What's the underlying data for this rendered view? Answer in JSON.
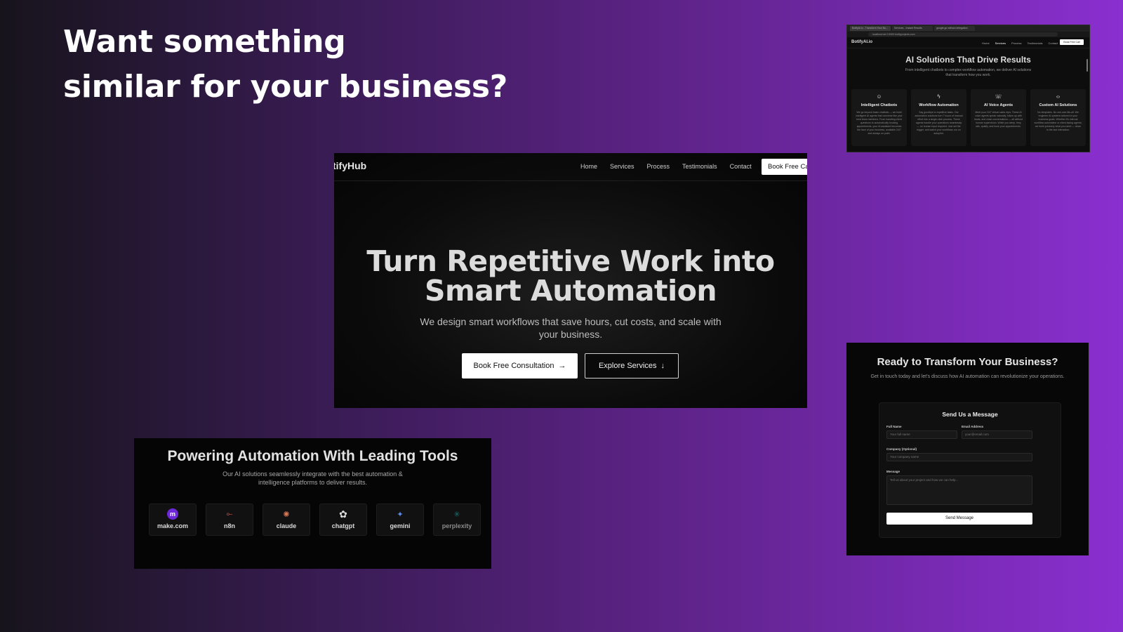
{
  "headline": {
    "line1": "Want something",
    "line2": "similar for your business?"
  },
  "hero": {
    "logo": "tifyHub",
    "nav": [
      "Home",
      "Services",
      "Process",
      "Testimonials",
      "Contact"
    ],
    "nav_cta": "Book Free Ca",
    "title_line1": "Turn Repetitive Work into",
    "title_line2": "Smart Automation",
    "subtitle": "We design smart workflows that save hours, cut costs, and scale with your business.",
    "primary_button": "Book Free Consultation",
    "primary_icon": "→",
    "secondary_button": "Explore Services",
    "secondary_icon": "↓"
  },
  "services_preview": {
    "tabs": [
      "BotifyAI.io - Transform Your Bu...",
      "Services - Instant Results",
      "google.go without delegation"
    ],
    "address": "localhost:net 3 5000 botifyprojects.com",
    "logo": "BotifyAI.io",
    "nav": [
      "Home",
      "Services",
      "Process",
      "Testimonials",
      "Contact"
    ],
    "nav_cta": "Book Free Call",
    "title": "AI Solutions That Drive Results",
    "subtitle": "From intelligent chatbots to complex workflow automation, we deliver AI solutions that transform how you work.",
    "cards": [
      {
        "icon": "robot-icon",
        "glyph": "☺",
        "title": "Intelligent Chatbots",
        "body": "We go beyond basic chatbots — we build intelligent AI agents that converse like your best team members. From handling client questions to automatically booking appointments, your AI assistant becomes the face of your business, available 24/7 and always on point."
      },
      {
        "icon": "lightning-icon",
        "glyph": "ϟ",
        "title": "Workflow Automation",
        "body": "Say goodbye to repetitive tasks. Our automation solutions turn 7 hours of manual effort into a single-click process. These agents handle your operations seamlessly — no human input required. Just set the trigger, and watch your workflows run on autopilot."
      },
      {
        "icon": "phone-icon",
        "glyph": "☏",
        "title": "AI Voice Agents",
        "body": "Meet your 24/7 virtual sales reps. These AI voice agents speak naturally, follow up with leads, and close conversations — all without human supervision. While you sleep, they talk, qualify, and book your appointments."
      },
      {
        "icon": "code-icon",
        "glyph": "‹›",
        "title": "Custom AI Solutions",
        "body": "No templates. No one-size-fits-all. We engineer AI systems tailored to your business goals. Whether it's internal workflow automation or client-facing agents, we build precisely what you need — down to the last interaction."
      }
    ]
  },
  "tools": {
    "title": "Powering Automation With Leading Tools",
    "subtitle": "Our AI solutions seamlessly integrate with the best automation & intelligence platforms to deliver results.",
    "items": [
      {
        "label": "make.com",
        "icon": "make-icon",
        "glyph": "m",
        "color": "#6d28d9"
      },
      {
        "label": "n8n",
        "icon": "n8n-icon",
        "glyph": "⟜",
        "color": "#e8625c"
      },
      {
        "label": "claude",
        "icon": "claude-icon",
        "glyph": "✺",
        "color": "#d97757"
      },
      {
        "label": "chatgpt",
        "icon": "chatgpt-icon",
        "glyph": "✿",
        "color": "#e0e0e0"
      },
      {
        "label": "gemini",
        "icon": "gemini-icon",
        "glyph": "✦",
        "color": "#5b8def"
      },
      {
        "label": "perplexity",
        "icon": "perplexity-icon",
        "glyph": "✳",
        "color": "#1f6f6f"
      }
    ]
  },
  "contact": {
    "title": "Ready to Transform Your Business?",
    "subtitle": "Get in touch today and let's discuss how AI automation can revolutionize your operations.",
    "form_title": "Send Us a Message",
    "full_name_label": "Full Name",
    "full_name_placeholder": "Your full name",
    "email_label": "Email Address",
    "email_placeholder": "your@email.com",
    "company_label": "Company (Optional)",
    "company_placeholder": "Your company name",
    "message_label": "Message",
    "message_placeholder": "Tell us about your project and how we can help...",
    "send_button": "Send Message"
  }
}
